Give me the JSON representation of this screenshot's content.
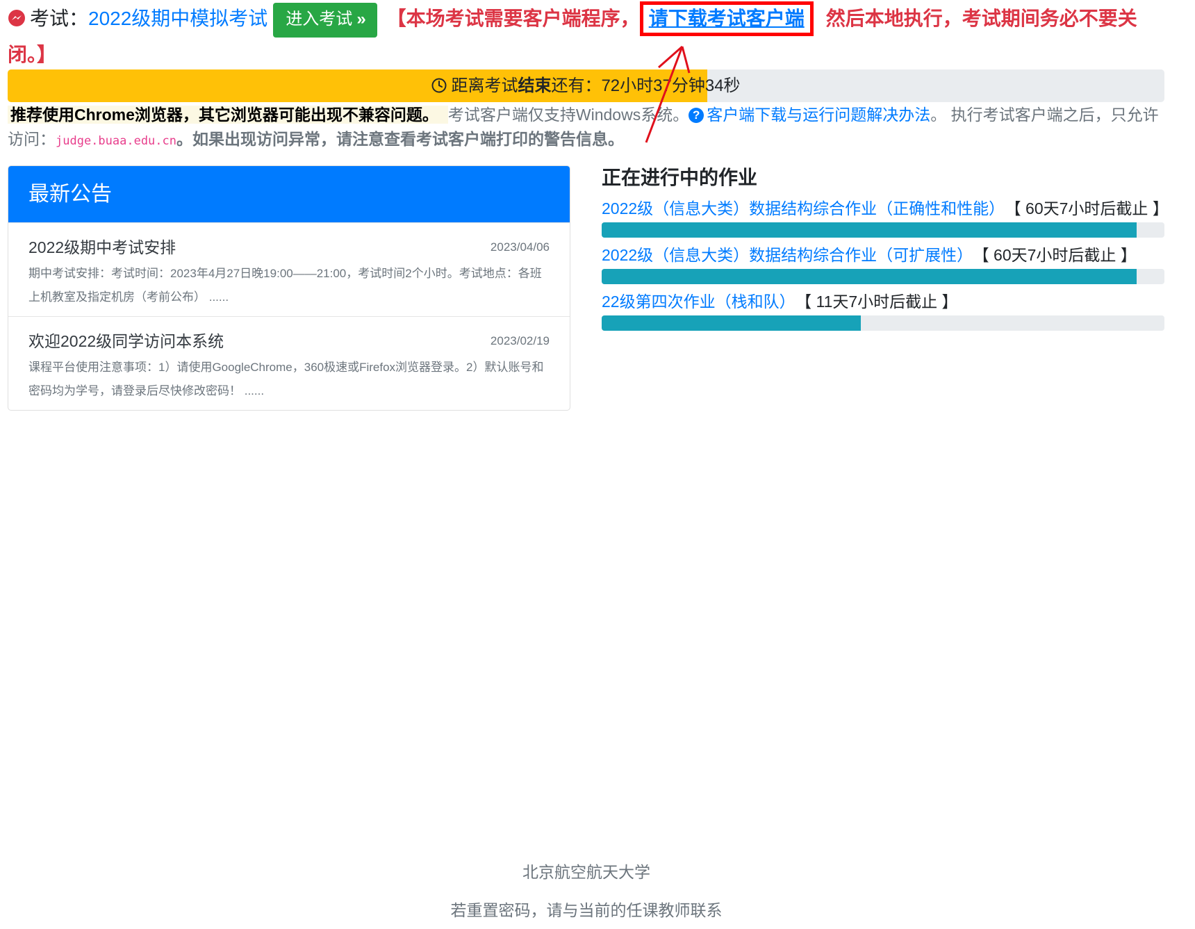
{
  "exam": {
    "prefix": "考试：",
    "name": "2022级期中模拟考试",
    "enter_button": "进入考试",
    "enter_arrows": "»",
    "warning_start": "【本场考试需要客户端程序，",
    "download_link": "请下载考试客户端",
    "warning_end": "然后本地执行，考试期间务必不要关闭。】"
  },
  "countdown": {
    "text_before": "距离考试",
    "text_bold": "结束",
    "text_after": "还有：72小时37分钟34秒",
    "progress_fraction": 0.605,
    "colors": {
      "fill": "#ffc107",
      "track": "#e9ecef"
    }
  },
  "notice": {
    "browser_tip": "推荐使用Chrome浏览器，其它浏览器可能出现不兼容问题。",
    "client_support": "考试客户端仅支持Windows系统。",
    "help_link": "客户端下载与运行问题解决办法",
    "after_help": "。 执行考试客户端之后，只允许访问：",
    "domain": "judge.buaa.edu.cn",
    "warning": "。如果出现访问异常，请注意查看考试客户端打印的警告信息。"
  },
  "announcements": {
    "header": "最新公告",
    "items": [
      {
        "title": "2022级期中考试安排",
        "date": "2023/04/06",
        "body": "期中考试安排：考试时间：2023年4月27日晚19:00——21:00，考试时间2个小时。考试地点：各班上机教室及指定机房（考前公布）  ......"
      },
      {
        "title": "欢迎2022级同学访问本系统",
        "date": "2023/02/19",
        "body": "课程平台使用注意事项：1）请使用GoogleChrome，360极速或Firefox浏览器登录。2）默认账号和密码均为学号，请登录后尽快修改密码！  ......"
      }
    ]
  },
  "homework": {
    "title": "正在进行中的作业",
    "items": [
      {
        "name": "2022级（信息大类）数据结构综合作业（正确性和性能）",
        "deadline": "【 60天7小时后截止 】",
        "progress": 0.95
      },
      {
        "name": "2022级（信息大类）数据结构综合作业（可扩展性）",
        "deadline": "【 60天7小时后截止 】",
        "progress": 0.95
      },
      {
        "name": "22级第四次作业（栈和队）",
        "deadline": "【 11天7小时后截止 】",
        "progress": 0.46
      }
    ],
    "bar_color": "#17a2b8"
  },
  "footer": {
    "university": "北京航空航天大学",
    "reset_tip": "若重置密码，请与当前的任课教师联系"
  }
}
